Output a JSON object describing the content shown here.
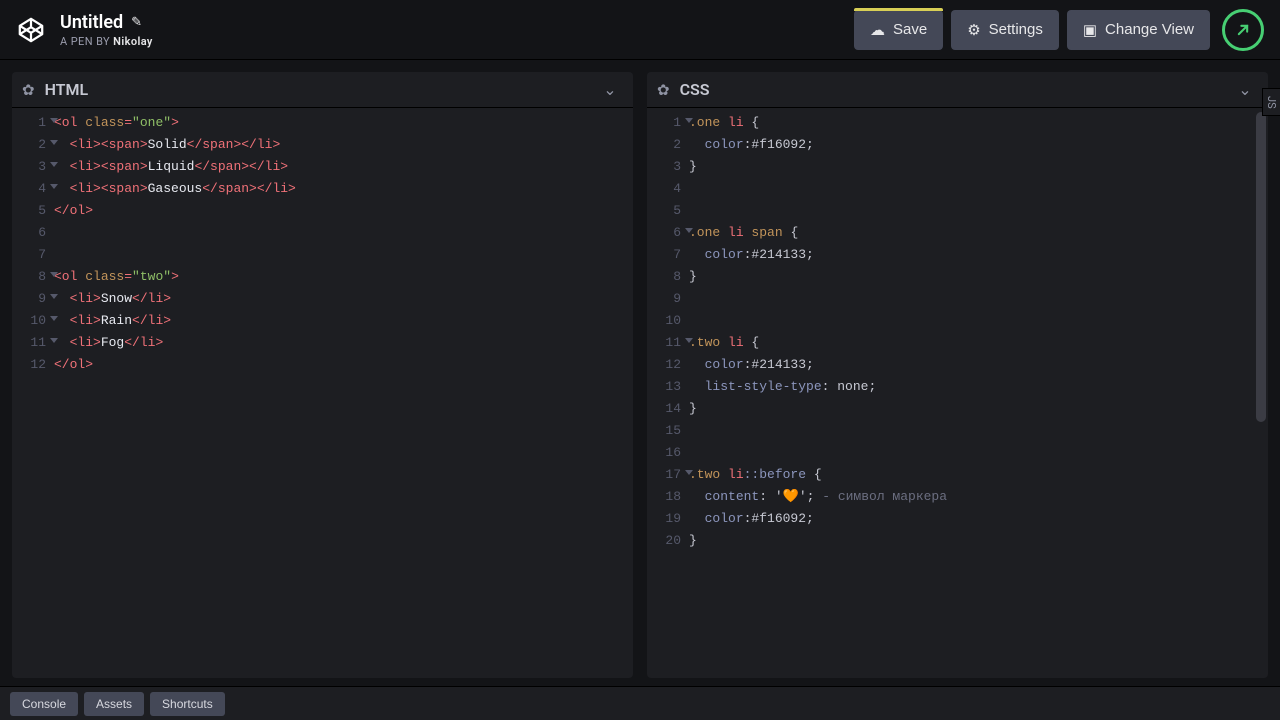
{
  "header": {
    "title": "Untitled",
    "subtitle_prefix": "A PEN BY ",
    "author": "Nikolay",
    "buttons": {
      "save": "Save",
      "settings": "Settings",
      "change_view": "Change View"
    }
  },
  "panels": {
    "html": {
      "title": "HTML"
    },
    "css": {
      "title": "CSS"
    }
  },
  "side_tab": "JS",
  "footer": {
    "console": "Console",
    "assets": "Assets",
    "shortcuts": "Shortcuts"
  },
  "code": {
    "html": [
      {
        "num": "1",
        "fold": true,
        "tokens": [
          [
            "tag",
            "<ol "
          ],
          [
            "attr",
            "class"
          ],
          [
            "tag",
            "="
          ],
          [
            "str",
            "\"one\""
          ],
          [
            "tag",
            ">"
          ]
        ]
      },
      {
        "num": "2",
        "fold": true,
        "indent": 1,
        "tokens": [
          [
            "tag",
            "<li><span>"
          ],
          [
            "txt",
            "Solid"
          ],
          [
            "tag",
            "</span></li>"
          ]
        ]
      },
      {
        "num": "3",
        "fold": true,
        "indent": 1,
        "tokens": [
          [
            "tag",
            "<li><span>"
          ],
          [
            "txt",
            "Liquid"
          ],
          [
            "tag",
            "</span></li>"
          ]
        ]
      },
      {
        "num": "4",
        "fold": true,
        "indent": 1,
        "tokens": [
          [
            "tag",
            "<li><span>"
          ],
          [
            "txt",
            "Gaseous"
          ],
          [
            "tag",
            "</span></li>"
          ]
        ]
      },
      {
        "num": "5",
        "tokens": [
          [
            "tag",
            "</ol>"
          ]
        ]
      },
      {
        "num": "6",
        "tokens": []
      },
      {
        "num": "7",
        "tokens": []
      },
      {
        "num": "8",
        "fold": true,
        "tokens": [
          [
            "tag",
            "<ol "
          ],
          [
            "attr",
            "class"
          ],
          [
            "tag",
            "="
          ],
          [
            "str",
            "\"two\""
          ],
          [
            "tag",
            ">"
          ]
        ]
      },
      {
        "num": "9",
        "fold": true,
        "indent": 1,
        "tokens": [
          [
            "tag",
            "<li>"
          ],
          [
            "txt",
            "Snow"
          ],
          [
            "tag",
            "</li>"
          ]
        ]
      },
      {
        "num": "10",
        "fold": true,
        "indent": 1,
        "tokens": [
          [
            "tag",
            "<li>"
          ],
          [
            "txt",
            "Rain"
          ],
          [
            "tag",
            "</li>"
          ]
        ]
      },
      {
        "num": "11",
        "fold": true,
        "indent": 1,
        "tokens": [
          [
            "tag",
            "<li>"
          ],
          [
            "txt",
            "Fog"
          ],
          [
            "tag",
            "</li>"
          ]
        ]
      },
      {
        "num": "12",
        "tokens": [
          [
            "tag",
            "</ol>"
          ]
        ]
      }
    ],
    "css": [
      {
        "num": "1",
        "fold": true,
        "tokens": [
          [
            "sel",
            ".one "
          ],
          [
            "sel-li",
            "li"
          ],
          [
            "val",
            " {"
          ]
        ]
      },
      {
        "num": "2",
        "indent": 1,
        "tokens": [
          [
            "prop",
            "color"
          ],
          [
            "val",
            ":#f16092;"
          ]
        ]
      },
      {
        "num": "3",
        "tokens": [
          [
            "val",
            "}"
          ]
        ]
      },
      {
        "num": "4",
        "tokens": []
      },
      {
        "num": "5",
        "tokens": []
      },
      {
        "num": "6",
        "fold": true,
        "tokens": [
          [
            "sel",
            ".one "
          ],
          [
            "sel-li",
            "li"
          ],
          [
            "sel",
            " span"
          ],
          [
            "val",
            " {"
          ]
        ]
      },
      {
        "num": "7",
        "indent": 1,
        "tokens": [
          [
            "prop",
            "color"
          ],
          [
            "val",
            ":#214133;"
          ]
        ]
      },
      {
        "num": "8",
        "tokens": [
          [
            "val",
            "}"
          ]
        ]
      },
      {
        "num": "9",
        "tokens": []
      },
      {
        "num": "10",
        "tokens": []
      },
      {
        "num": "11",
        "fold": true,
        "tokens": [
          [
            "sel",
            ".two "
          ],
          [
            "sel-li",
            "li"
          ],
          [
            "val",
            " {"
          ]
        ]
      },
      {
        "num": "12",
        "indent": 1,
        "tokens": [
          [
            "prop",
            "color"
          ],
          [
            "val",
            ":#214133;"
          ]
        ]
      },
      {
        "num": "13",
        "indent": 1,
        "tokens": [
          [
            "prop",
            "list-style-type"
          ],
          [
            "val",
            ": none;"
          ]
        ]
      },
      {
        "num": "14",
        "tokens": [
          [
            "val",
            "}"
          ]
        ]
      },
      {
        "num": "15",
        "tokens": []
      },
      {
        "num": "16",
        "tokens": []
      },
      {
        "num": "17",
        "fold": true,
        "tokens": [
          [
            "sel",
            ".two "
          ],
          [
            "sel-li",
            "li"
          ],
          [
            "prop",
            "::before"
          ],
          [
            "val",
            " {"
          ]
        ]
      },
      {
        "num": "18",
        "indent": 1,
        "tokens": [
          [
            "prop",
            "content"
          ],
          [
            "val",
            ": '"
          ],
          [
            "heart",
            "🧡"
          ],
          [
            "val",
            "'; "
          ],
          [
            "comm",
            "- символ маркера"
          ]
        ]
      },
      {
        "num": "19",
        "indent": 1,
        "tokens": [
          [
            "prop",
            "color"
          ],
          [
            "val",
            ":#f16092;"
          ]
        ]
      },
      {
        "num": "20",
        "tokens": [
          [
            "val",
            "}"
          ]
        ]
      }
    ]
  }
}
